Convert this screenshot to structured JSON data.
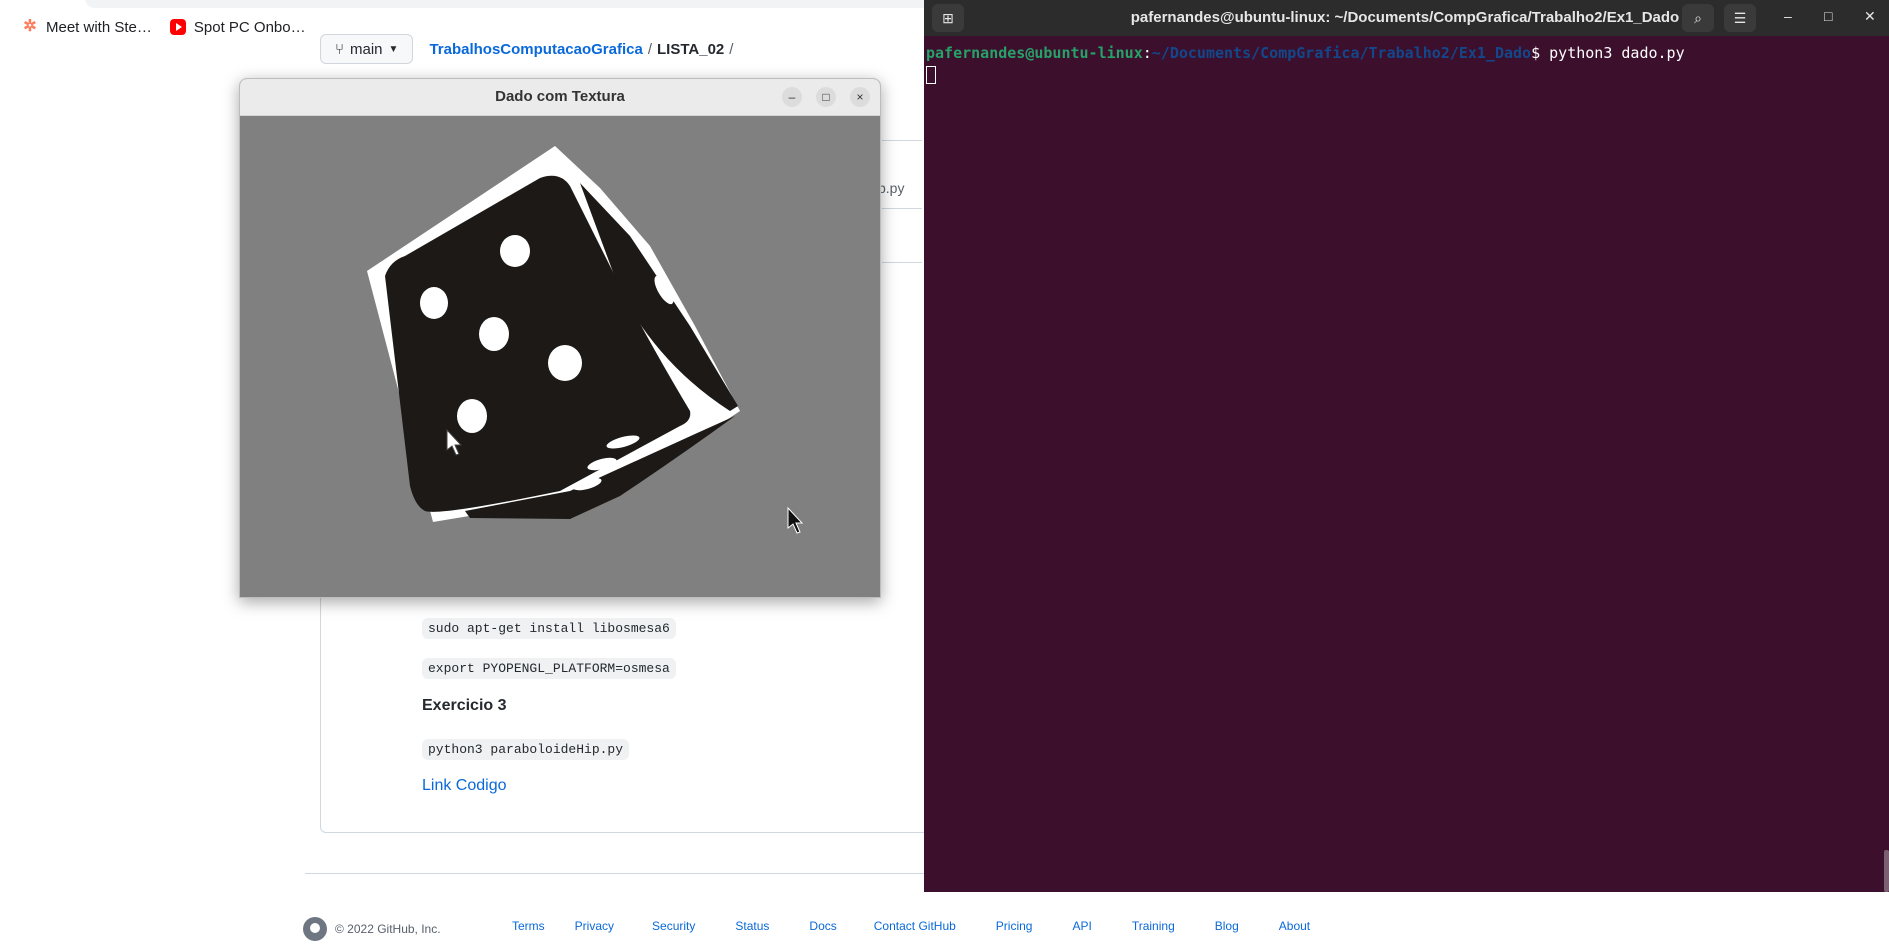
{
  "browser": {
    "bookmarks": [
      {
        "icon": "hubspot-icon",
        "label": "Meet with Ste…"
      },
      {
        "icon": "youtube-icon",
        "label": "Spot PC Onbo…"
      }
    ],
    "github": {
      "branch": "main",
      "repo": "TrabalhosComputacaoGrafica",
      "folder": "LISTA_02",
      "separator": "/",
      "partial_file": "p.py"
    },
    "readme": {
      "code1": "sudo apt-get install libosmesa6",
      "code2": "export PYOPENGL_PLATFORM=osmesa",
      "heading": "Exercicio 3",
      "code3": "python3 paraboloideHip.py",
      "link": "Link Codigo"
    },
    "footer": {
      "copyright": "© 2022 GitHub, Inc.",
      "links": [
        "Terms",
        "Privacy",
        "Security",
        "Status",
        "Docs",
        "Contact GitHub",
        "Pricing",
        "API",
        "Training",
        "Blog",
        "About"
      ]
    }
  },
  "dice_window": {
    "title": "Dado com Textura",
    "buttons": {
      "minimize": "–",
      "maximize": "□",
      "close": "×"
    },
    "colors": {
      "background": "#808080",
      "face": "#1c1917",
      "pip": "#ffffff"
    }
  },
  "terminal": {
    "title": "pafernandes@ubuntu-linux: ~/Documents/CompGrafica/Trabalho2/Ex1_Dado",
    "prompt_user": "pafernandes@ubuntu-linux",
    "prompt_sep": ":",
    "prompt_path": "~/Documents/CompGrafica/Trabalho2/Ex1_Dado",
    "prompt_symbol": "$",
    "command": " python3 dado.py",
    "colors": {
      "background": "#3c0f2c",
      "user": "#26a269",
      "path": "#12488b"
    }
  }
}
